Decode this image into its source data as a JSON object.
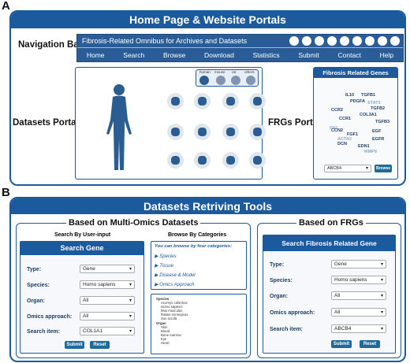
{
  "panel_a": {
    "label": "A",
    "banner": "Home Page & Website Portals",
    "nav_label": "Navigation Bar",
    "nav_title": "Fibrosis-Related Omnibus for Archives and Datasets",
    "nav_items": [
      "Home",
      "Search",
      "Browse",
      "Download",
      "Statistics",
      "Submit",
      "Contact",
      "Help"
    ],
    "datasets_label": "Datasets Portals",
    "species_tabs": [
      "human",
      "mouse",
      "rat",
      "others"
    ],
    "frgs_label": "FRGs Portal",
    "frg_title": "Fibrosis Related Genes",
    "genes": [
      "IL10",
      "TGFB1",
      "PDGFA",
      "STAT3",
      "TGFB2",
      "CCR2",
      "COL3A1",
      "CCR1",
      "TGFB3",
      "FN1",
      "FGF1",
      "CCN2",
      "EGF",
      "ACTA2",
      "EGFR",
      "DCN",
      "EDN1",
      "MMP9"
    ],
    "frg_select": "ABCB4",
    "frg_button": "Browse"
  },
  "panel_b": {
    "label": "B",
    "banner": "Datasets Retriving Tools",
    "multi_title": "Based on Multi-Omics Datasets",
    "frg_side_title": "Based on FRGs",
    "user_input_title": "Search By User-input",
    "categories_title": "Browse By Categories",
    "left_form": {
      "head": "Search Gene",
      "rows": [
        {
          "label": "Type:",
          "value": "Gene"
        },
        {
          "label": "Species:",
          "value": "Homo sapiens"
        },
        {
          "label": "Organ:",
          "value": "All"
        },
        {
          "label": "Omics approach:",
          "value": "All"
        },
        {
          "label": "Search item:",
          "value": "COL1A1"
        }
      ],
      "submit": "Submit",
      "reset": "Reset"
    },
    "categories": {
      "intro": "You can browse by four categories:",
      "items": [
        "Species",
        "Tissue",
        "Disease & Model",
        "Omics Approach"
      ],
      "tree": [
        "Species",
        "Acomys cahirinus",
        "Homo sapiens",
        "Mus musculus",
        "Rattus norvegicus",
        "Sus scrofa",
        "Organ",
        "Skin",
        "Blood",
        "Bone marrow",
        "Eye",
        "Heart"
      ]
    },
    "right_form": {
      "head": "Search Fibrosis Related Gene",
      "rows": [
        {
          "label": "Type:",
          "value": "Gene"
        },
        {
          "label": "Species:",
          "value": "Homo sapiens"
        },
        {
          "label": "Organ:",
          "value": "All"
        },
        {
          "label": "Omics approach:",
          "value": "All"
        },
        {
          "label": "Search item:",
          "value": "ABCB4"
        }
      ],
      "submit": "Submit",
      "reset": "Reset"
    }
  }
}
